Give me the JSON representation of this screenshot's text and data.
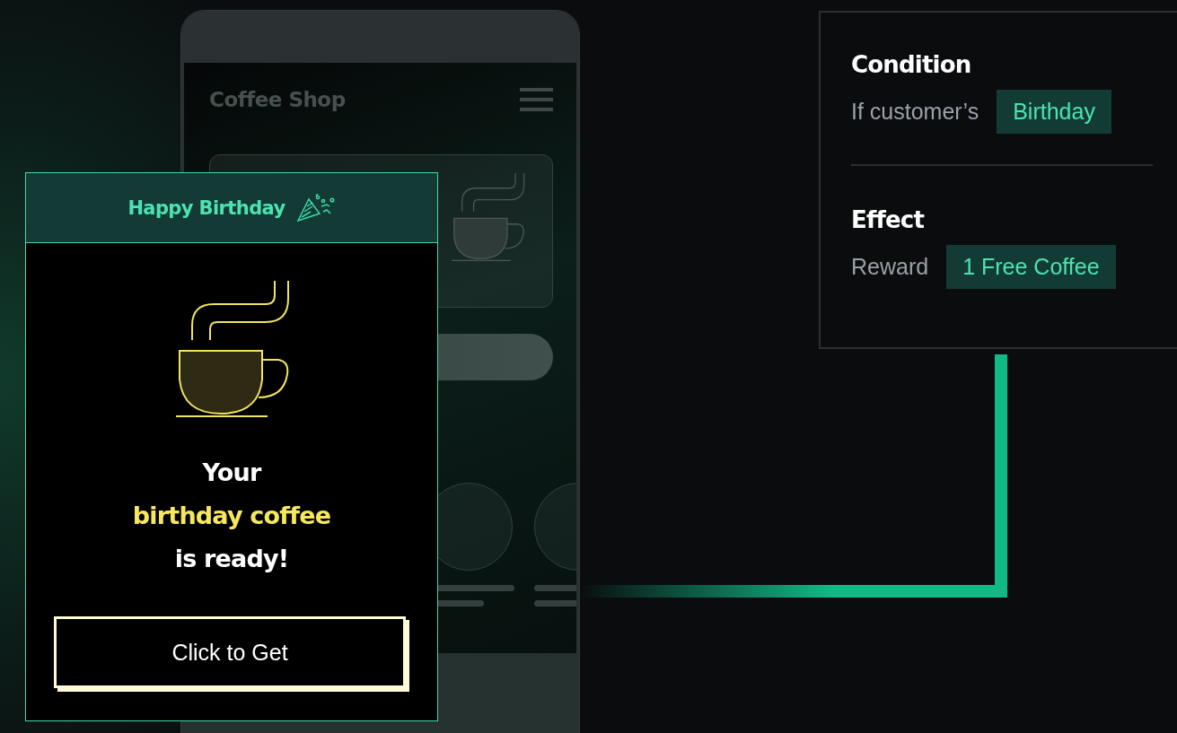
{
  "phone": {
    "app_title": "Coffee Shop"
  },
  "popup": {
    "header": "Happy Birthday",
    "message": [
      {
        "text": "Your",
        "highlight": false
      },
      {
        "text": "birthday coffee",
        "highlight": true
      },
      {
        "text": "is ready!",
        "highlight": false
      }
    ],
    "button": "Click to Get"
  },
  "rule": {
    "sections": [
      {
        "heading": "Condition",
        "label": "If customer’s",
        "value": "Birthday"
      },
      {
        "heading": "Effect",
        "label": "Reward",
        "value": "1 Free Coffee"
      }
    ]
  }
}
